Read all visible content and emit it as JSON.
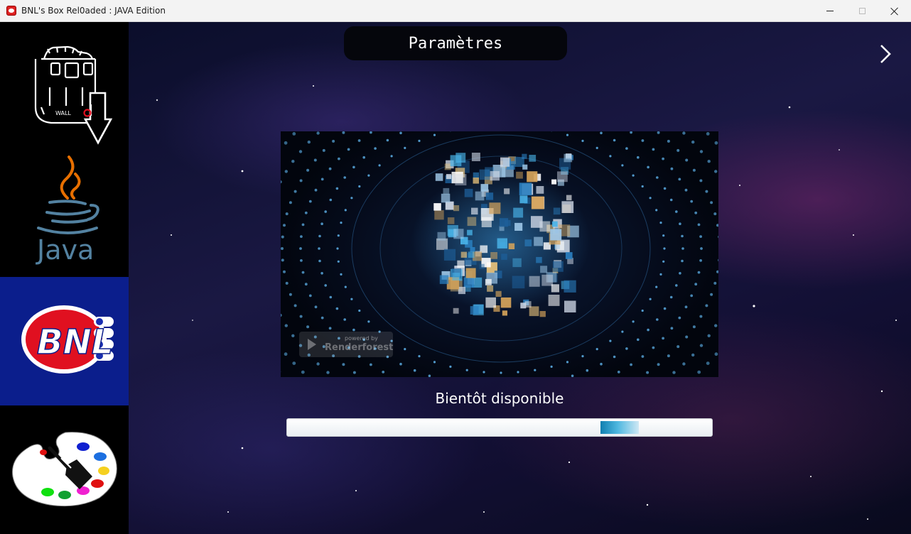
{
  "window": {
    "title": "BNL's Box Rel0aded : JAVA Edition",
    "icon": "bnl-app-icon",
    "controls": [
      "minimize",
      "maximize",
      "close"
    ]
  },
  "sidebar": {
    "items": [
      {
        "name": "wall-e",
        "logo_text": "WALL",
        "icon": "wall-e-download-icon"
      },
      {
        "name": "java",
        "logo_text": "Java",
        "icon": "java-icon"
      },
      {
        "name": "bnl",
        "logo_text": "BNL",
        "icon": "bnl-logo-icon",
        "active": true
      },
      {
        "name": "paint",
        "icon": "paint-palette-icon"
      }
    ]
  },
  "main": {
    "title": "Paramètres",
    "next_icon": "chevron-right-icon",
    "video": {
      "watermark_small": "powered by",
      "watermark_brand": "Renderforest"
    },
    "status_text": "Bientôt disponible",
    "progress": {
      "mode": "indeterminate",
      "position": 0.81
    }
  },
  "colors": {
    "active_sidebar": "#0b1e8c",
    "accent_blue": "#1f8fc0",
    "bnl_red": "#e01020"
  }
}
